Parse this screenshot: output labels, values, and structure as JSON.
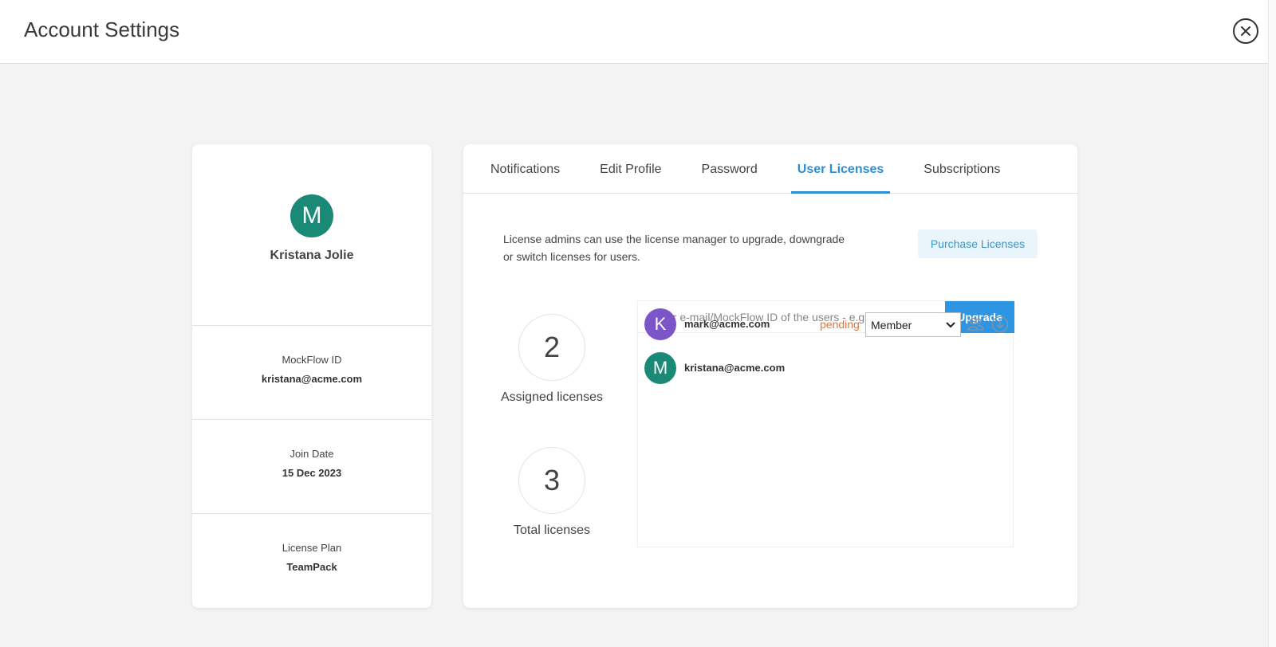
{
  "header": {
    "title": "Account Settings"
  },
  "profile": {
    "avatar_initial": "M",
    "avatar_color": "#1a8a76",
    "name": "Kristana Jolie",
    "info": [
      {
        "label": "MockFlow ID",
        "value": "kristana@acme.com"
      },
      {
        "label": "Join Date",
        "value": "15 Dec 2023"
      },
      {
        "label": "License Plan",
        "value": "TeamPack"
      }
    ]
  },
  "tabs": [
    {
      "label": "Notifications",
      "active": false
    },
    {
      "label": "Edit Profile",
      "active": false
    },
    {
      "label": "Password",
      "active": false
    },
    {
      "label": "User Licenses",
      "active": true
    },
    {
      "label": "Subscriptions",
      "active": false
    }
  ],
  "licenses": {
    "description": "License admins can use the license manager to upgrade, downgrade or switch licenses for users.",
    "purchase_label": "Purchase Licenses",
    "assigned": {
      "count": "2",
      "label": "Assigned licenses"
    },
    "total": {
      "count": "3",
      "label": "Total licenses"
    },
    "invite": {
      "placeholder": "Enter e-mail/MockFlow ID of the users - e.g.: matt@acme.com",
      "button_label": "Upgrade"
    },
    "users": [
      {
        "initial": "K",
        "color": "#7c55c8",
        "email": "mark@acme.com",
        "status": "pending",
        "role": "Member"
      },
      {
        "initial": "M",
        "color": "#1a8a76",
        "email": "kristana@acme.com",
        "status": "",
        "role": ""
      }
    ]
  },
  "colors": {
    "accent": "#2e8fd4",
    "pending": "#e2733a"
  }
}
